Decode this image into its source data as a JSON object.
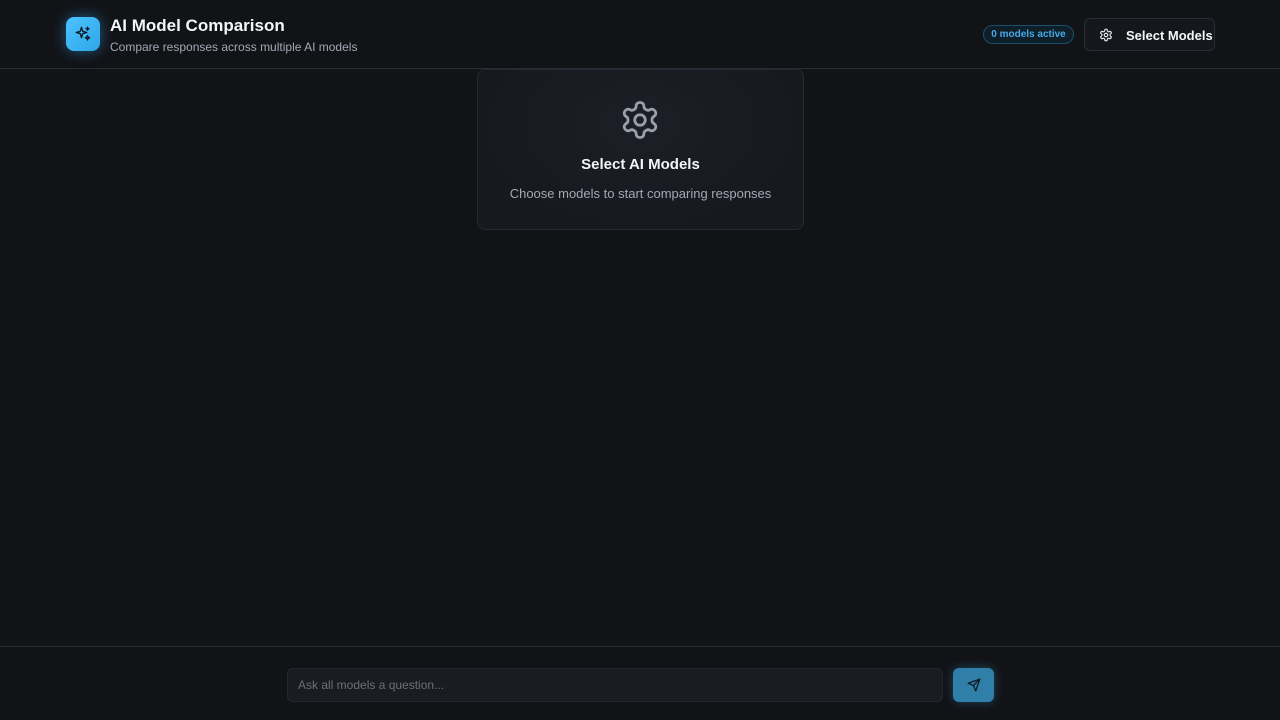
{
  "header": {
    "title": "AI Model Comparison",
    "subtitle": "Compare responses across multiple AI models",
    "logo_icon": "sparkles-icon",
    "active_badge": "0 models active",
    "select_button_label": "Select Models",
    "select_button_icon": "gear-icon"
  },
  "empty_state": {
    "icon": "gear-icon",
    "heading": "Select AI Models",
    "description": "Choose models to start comparing responses"
  },
  "composer": {
    "placeholder": "Ask all models a question...",
    "value": "",
    "send_icon": "send-icon"
  },
  "colors": {
    "background": "#121317",
    "accent": "#4cc3ff",
    "badge_text": "#48a9e6",
    "send_button": "#2f7fa8"
  }
}
